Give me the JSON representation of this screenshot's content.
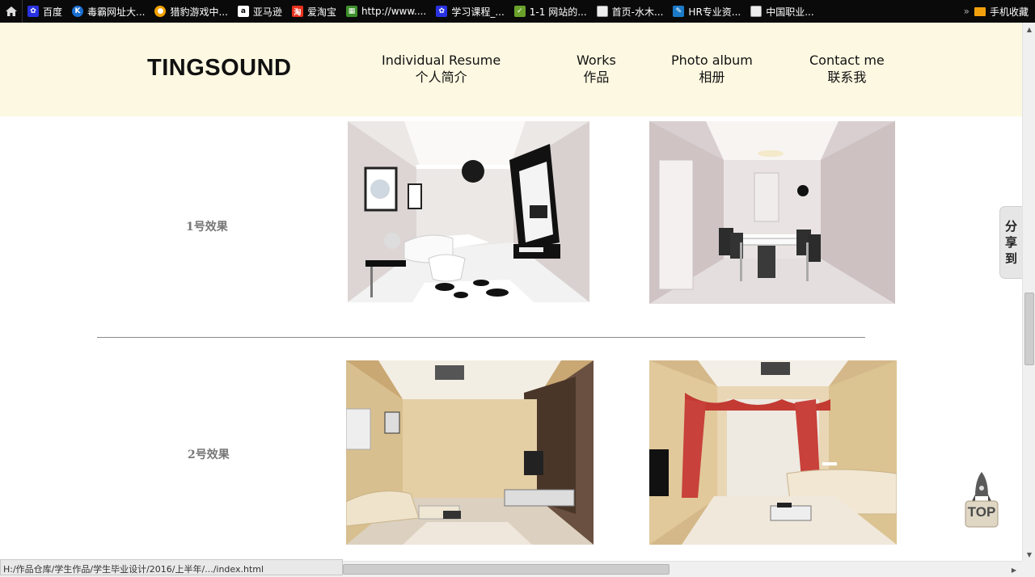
{
  "bookmarks": [
    {
      "label": "百度",
      "icon": "baidu-paw-icon",
      "color": "#2932e1"
    },
    {
      "label": "毒霸网址大...",
      "icon": "duba-k-icon",
      "color": "#1a6fd1"
    },
    {
      "label": "猎豹游戏中...",
      "icon": "liebao-game-icon",
      "color": "#f0a000"
    },
    {
      "label": "亚马逊",
      "icon": "amazon-a-icon",
      "color": "#ffffff"
    },
    {
      "label": "爱淘宝",
      "icon": "taobao-icon",
      "color": "#e8321e"
    },
    {
      "label": "http://www....",
      "icon": "grid-icon",
      "color": "#3c8f2a"
    },
    {
      "label": "学习课程_...",
      "icon": "baidu-paw-icon",
      "color": "#2932e1"
    },
    {
      "label": "1-1 网站的...",
      "icon": "shield-icon",
      "color": "#6aa12b"
    },
    {
      "label": "首页-水木...",
      "icon": "page-icon",
      "color": "#eeeeee"
    },
    {
      "label": "HR专业资...",
      "icon": "hr-icon",
      "color": "#1b7bc8"
    },
    {
      "label": "中国职业...",
      "icon": "page-icon",
      "color": "#eeeeee"
    }
  ],
  "bookmark_more": "»",
  "mobile_bookmarks": "手机收藏",
  "site": {
    "logo": "TINGSOUND",
    "nav": [
      {
        "en": "Individual Resume",
        "zh": "个人简介"
      },
      {
        "en": "Works",
        "zh": "作品"
      },
      {
        "en": "Photo album",
        "zh": "相册"
      },
      {
        "en": "Contact me",
        "zh": "联系我"
      }
    ]
  },
  "gallery": {
    "rows": [
      {
        "label": "1号效果"
      },
      {
        "label": "2号效果"
      }
    ]
  },
  "share_tab": {
    "chars": [
      "分",
      "享",
      "到"
    ]
  },
  "top_button": {
    "label": "TOP"
  },
  "status_bar": {
    "text": "H:/作品仓库/学生作品/学生毕业设计/2016/上半年/.../index.html"
  },
  "colors": {
    "header_bg": "#fdf8e1",
    "label_gray": "#777777"
  }
}
